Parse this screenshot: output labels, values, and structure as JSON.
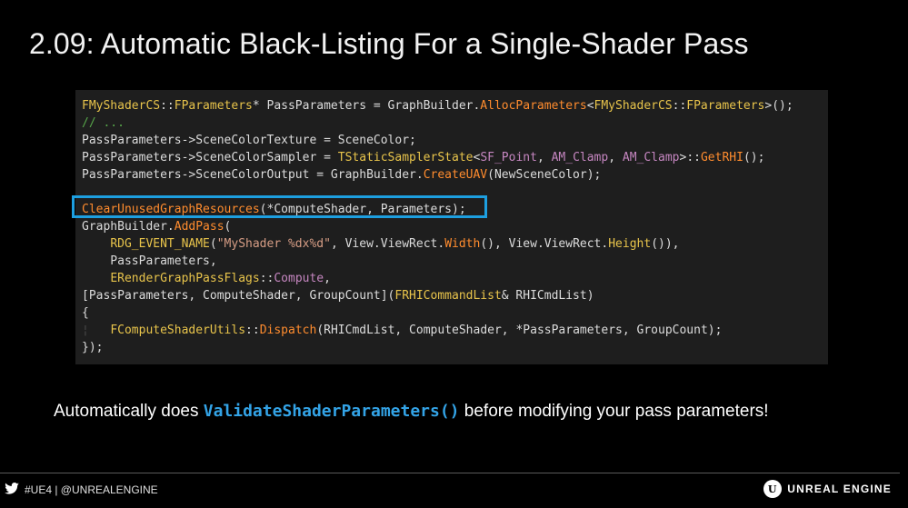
{
  "slide": {
    "title": "2.09: Automatic Black-Listing For a Single-Shader Pass"
  },
  "code": {
    "lines": [
      [
        {
          "t": "FMyShaderCS",
          "c": "type"
        },
        {
          "t": "::",
          "c": "plain"
        },
        {
          "t": "FParameters",
          "c": "type"
        },
        {
          "t": "* PassParameters = GraphBuilder.",
          "c": "plain"
        },
        {
          "t": "AllocParameters",
          "c": "func"
        },
        {
          "t": "<",
          "c": "plain"
        },
        {
          "t": "FMyShaderCS",
          "c": "type"
        },
        {
          "t": "::",
          "c": "plain"
        },
        {
          "t": "FParameters",
          "c": "type"
        },
        {
          "t": ">();",
          "c": "plain"
        }
      ],
      [
        {
          "t": "// ...",
          "c": "comment"
        }
      ],
      [
        {
          "t": "PassParameters->SceneColorTexture = SceneColor;",
          "c": "plain"
        }
      ],
      [
        {
          "t": "PassParameters->SceneColorSampler = ",
          "c": "plain"
        },
        {
          "t": "TStaticSamplerState",
          "c": "type"
        },
        {
          "t": "<",
          "c": "plain"
        },
        {
          "t": "SF_Point",
          "c": "tmpl"
        },
        {
          "t": ", ",
          "c": "plain"
        },
        {
          "t": "AM_Clamp",
          "c": "tmpl"
        },
        {
          "t": ", ",
          "c": "plain"
        },
        {
          "t": "AM_Clamp",
          "c": "tmpl"
        },
        {
          "t": ">::",
          "c": "plain"
        },
        {
          "t": "GetRHI",
          "c": "func"
        },
        {
          "t": "();",
          "c": "plain"
        }
      ],
      [
        {
          "t": "PassParameters->SceneColorOutput = GraphBuilder.",
          "c": "plain"
        },
        {
          "t": "CreateUAV",
          "c": "func"
        },
        {
          "t": "(NewSceneColor);",
          "c": "plain"
        }
      ],
      [],
      [
        {
          "t": "ClearUnusedGraphResources",
          "c": "func"
        },
        {
          "t": "(*ComputeShader, Parameters);",
          "c": "plain"
        }
      ],
      [
        {
          "t": "GraphBuilder.",
          "c": "plain"
        },
        {
          "t": "AddPass",
          "c": "func"
        },
        {
          "t": "(",
          "c": "plain"
        }
      ],
      [
        {
          "t": "    ",
          "c": "plain"
        },
        {
          "t": "RDG_EVENT_NAME",
          "c": "macro"
        },
        {
          "t": "(",
          "c": "plain"
        },
        {
          "t": "\"MyShader %dx%d\"",
          "c": "str"
        },
        {
          "t": ", View.ViewRect.",
          "c": "plain"
        },
        {
          "t": "Width",
          "c": "func"
        },
        {
          "t": "(), View.ViewRect.",
          "c": "plain"
        },
        {
          "t": "Height",
          "c": "macro"
        },
        {
          "t": "()),",
          "c": "plain"
        }
      ],
      [
        {
          "t": "    PassParameters,",
          "c": "plain"
        }
      ],
      [
        {
          "t": "    ",
          "c": "plain"
        },
        {
          "t": "ERenderGraphPassFlags",
          "c": "type"
        },
        {
          "t": "::",
          "c": "plain"
        },
        {
          "t": "Compute",
          "c": "tmpl"
        },
        {
          "t": ",",
          "c": "plain"
        }
      ],
      [
        {
          "t": "[PassParameters, ComputeShader, GroupCount](",
          "c": "plain"
        },
        {
          "t": "FRHICommandList",
          "c": "type"
        },
        {
          "t": "& RHICmdList)",
          "c": "plain"
        }
      ],
      [
        {
          "t": "{",
          "c": "plain"
        }
      ],
      [
        {
          "t": "¦   ",
          "c": "guide"
        },
        {
          "t": "FComputeShaderUtils",
          "c": "type"
        },
        {
          "t": "::",
          "c": "plain"
        },
        {
          "t": "Dispatch",
          "c": "func"
        },
        {
          "t": "(RHICmdList, ComputeShader, *PassParameters, GroupCount);",
          "c": "plain"
        }
      ],
      [
        {
          "t": "});",
          "c": "plain"
        }
      ]
    ]
  },
  "caption": {
    "prefix": "Automatically does ",
    "code": "ValidateShaderParameters()",
    "suffix": " before modifying your pass parameters!"
  },
  "footer": {
    "left_icon": "twitter-bird-icon",
    "left_text": "#UE4 | @UNREALENGINE",
    "right_logo": "unreal-engine-logo-icon",
    "right_text": "UNREAL ENGINE"
  },
  "colors": {
    "background": "#000000",
    "code_panel": "#1e1e1e",
    "highlight_border": "#1d9fe0",
    "caption_code": "#33a3e6"
  }
}
